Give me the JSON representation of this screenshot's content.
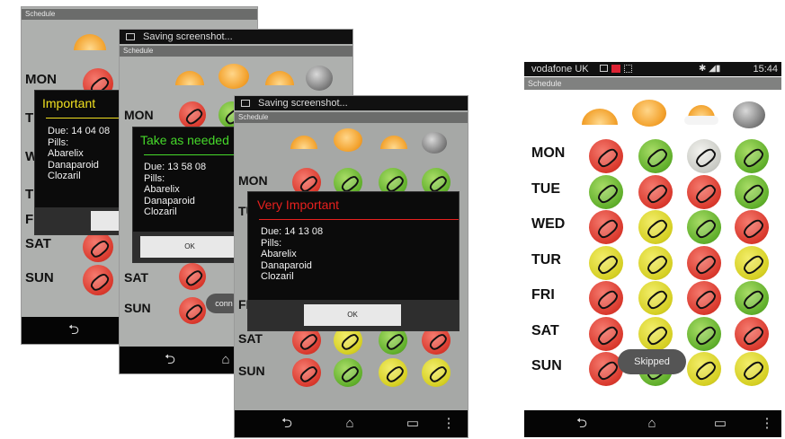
{
  "app": {
    "title": "Schedule"
  },
  "status": {
    "saving": "Saving screenshot..."
  },
  "days": [
    "MON",
    "TUE",
    "WED",
    "TUR",
    "FRI",
    "SAT",
    "SUN"
  ],
  "phone1": {
    "dialog": {
      "title": "Important",
      "title_color": "#f0e020",
      "due": "Due: 14 04 08",
      "pills_label": "Pills:",
      "pills": [
        "Abarelix",
        "Danaparoid",
        "Clozaril"
      ]
    },
    "partial_days": [
      "MON",
      "T",
      "W",
      "T",
      "F",
      "SAT",
      "SUN"
    ]
  },
  "phone2": {
    "dialog": {
      "title": "Take as needed",
      "title_color": "#46d82a",
      "due": "Due: 13 58 08",
      "pills_label": "Pills:",
      "pills": [
        "Abarelix",
        "Danaparoid",
        "Clozaril"
      ],
      "ok": "OK"
    },
    "toast": "conn"
  },
  "phone3": {
    "dialog": {
      "title": "Very Important",
      "title_color": "#e8201e",
      "due": "Due: 14 13 08",
      "pills_label": "Pills:",
      "pills": [
        "Abarelix",
        "Danaparoid",
        "Clozaril"
      ],
      "ok": "OK"
    }
  },
  "phone4": {
    "status": {
      "carrier": "vodafone UK",
      "time": "15:44"
    },
    "toast": "Skipped",
    "grid": [
      [
        "red",
        "green",
        "grey",
        "green"
      ],
      [
        "green",
        "red",
        "red",
        "green"
      ],
      [
        "red",
        "yellow",
        "green",
        "red"
      ],
      [
        "yellow",
        "yellow",
        "red",
        "yellow"
      ],
      [
        "red",
        "yellow",
        "red",
        "green"
      ],
      [
        "red",
        "yellow",
        "green",
        "red"
      ],
      [
        "red",
        "green",
        "yellow",
        "yellow"
      ]
    ]
  },
  "colors": {
    "red": "#d9382c",
    "green": "#5fae2a",
    "yellow": "#d5cf22",
    "grey": "#c9cac4"
  },
  "icons": {
    "time_of_day": [
      "sunrise-icon",
      "sun-icon",
      "sun-cloud-icon",
      "moon-icon"
    ],
    "nav": [
      "back-icon",
      "home-icon",
      "recents-icon",
      "menu-icon"
    ]
  }
}
